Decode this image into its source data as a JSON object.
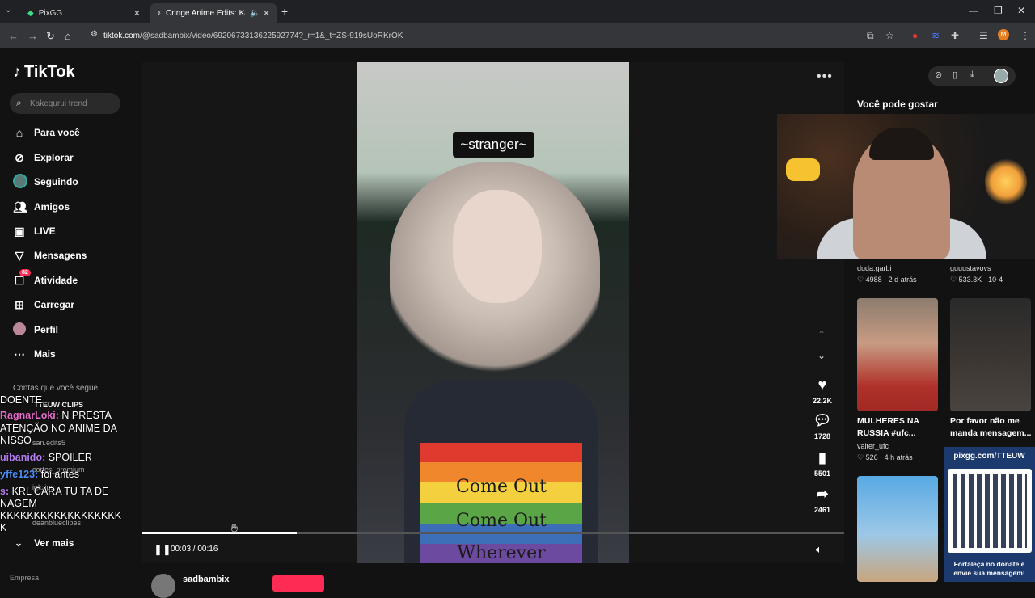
{
  "browser": {
    "tabs": [
      {
        "title": "PixGG",
        "icon": "pixgg-icon"
      },
      {
        "title": "Cringe Anime Edits: Kakeg",
        "icon": "tiktok-icon",
        "muted_icon": "speaker-icon"
      }
    ],
    "new_tab": "+",
    "url_domain": "tiktok.com",
    "url_path": "/@sadbambix/video/6920673313622592774?_r=1&_t=ZS-919sUoRKrOK"
  },
  "sidebar": {
    "logo": "TikTok",
    "search_placeholder": "Kakegurui trend",
    "nav": [
      {
        "label": "Para você",
        "icon": "home-icon"
      },
      {
        "label": "Explorar",
        "icon": "compass-icon"
      },
      {
        "label": "Seguindo",
        "icon": "following-avatar-icon"
      },
      {
        "label": "Amigos",
        "icon": "friends-icon"
      },
      {
        "label": "LIVE",
        "icon": "live-icon"
      },
      {
        "label": "Mensagens",
        "icon": "messages-icon"
      },
      {
        "label": "Atividade",
        "icon": "activity-icon",
        "badge": "82"
      },
      {
        "label": "Carregar",
        "icon": "upload-icon"
      },
      {
        "label": "Perfil",
        "icon": "profile-avatar-icon"
      },
      {
        "label": "Mais",
        "icon": "more-icon"
      }
    ],
    "following_title": "Contas que você segue",
    "accounts": [
      "TTEUW CLIPS",
      "san.edits5",
      "cortes_premium",
      "iglclips",
      "deanblueclipes"
    ],
    "see_more": "Ver mais",
    "footer": "Empresa"
  },
  "chat": [
    {
      "user": "",
      "text": "DOENTE",
      "color": "#ffffff"
    },
    {
      "user": "RagnarLoki:",
      "text": " N PRESTA",
      "color": "#e86bd0"
    },
    {
      "user": "",
      "text": "ATENÇÃO NO ANIME DA",
      "color": "#ffffff"
    },
    {
      "user": "",
      "text": "NISSO",
      "color": "#ffffff"
    },
    {
      "user": "uibanido:",
      "text": " SPOILER",
      "color": "#b67cf2"
    },
    {
      "user": "yffe123:",
      "text": " foi antes",
      "color": "#4d8df5"
    },
    {
      "user": "s:",
      "text": " KRL CARA TU TA DE",
      "color": "#b67cf2"
    },
    {
      "user": "",
      "text": "NAGEM",
      "color": "#ffffff"
    },
    {
      "user": "",
      "text": "KKKKKKKKKKKKKKKKKK",
      "color": "#ffffff"
    },
    {
      "user": "",
      "text": "K",
      "color": "#ffffff"
    }
  ],
  "video": {
    "caption": "~stranger~",
    "shirt_lines": [
      "Come Out",
      "Come Out",
      "Wherever"
    ],
    "actions": [
      {
        "icon": "heart-icon",
        "count": "22.2K"
      },
      {
        "icon": "comment-icon",
        "count": "1728"
      },
      {
        "icon": "bookmark-icon",
        "count": "5501"
      },
      {
        "icon": "share-icon",
        "count": "2461"
      }
    ],
    "time": "00:03 / 00:16",
    "progress": 0.22,
    "author": "sadbambix"
  },
  "right": {
    "title": "Você pode gostar",
    "cards": [
      {
        "user": "duda.garbi",
        "likes": "4988",
        "ago": "2 d atrás",
        "title": ""
      },
      {
        "user": "guuustavovs",
        "likes": "533.3K",
        "ago": "10-4",
        "title": ""
      },
      {
        "user": "valter_ufc",
        "likes": "526",
        "ago": "4 h atrás",
        "title": "MULHERES NA RUSSIA #ufc..."
      },
      {
        "user": "",
        "likes": "",
        "ago": "",
        "title": "Por favor não me manda mensagem..."
      }
    ],
    "qr_title": "pixgg.com/TTEUW",
    "qr_footer": "Fortaleça no donate e envie sua mensagem!"
  },
  "colors": {
    "accent": "#fe2c55",
    "background": "#121212"
  }
}
